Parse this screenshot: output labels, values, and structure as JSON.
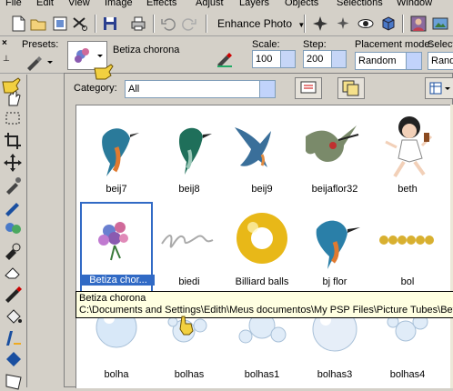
{
  "menu": [
    "File",
    "Edit",
    "View",
    "Image",
    "Effects",
    "Adjust",
    "Layers",
    "Objects",
    "Selections",
    "Window"
  ],
  "toolbar": {
    "enhance_photo": "Enhance Photo"
  },
  "options": {
    "presets_label": "Presets:",
    "tube_name": "Betiza chorona",
    "scale_label": "Scale:",
    "scale_value": "100",
    "step_label": "Step:",
    "step_value": "200",
    "placement_label": "Placement mode:",
    "placement_value": "Random",
    "selection_label": "Selecti",
    "selection_value": "Rando"
  },
  "browser": {
    "category_label": "Category:",
    "category_value": "All",
    "items": [
      "beij7",
      "beij8",
      "beij9",
      "beijaflor32",
      "beth",
      "Betiza chor...",
      "biedi",
      "Billiard balls",
      "bj flor",
      "bol",
      "bolha",
      "bolhas",
      "bolhas1",
      "bolhas3",
      "bolhas4"
    ],
    "selected_index": 5
  },
  "tooltip": {
    "title": "Betiza chorona",
    "path": "C:\\Documents and Settings\\Edith\\Meus documentos\\My PSP Files\\Picture Tubes\\Betiza"
  },
  "colors": {
    "selection": "#316ac5",
    "tooltip_bg": "#ffffe1",
    "face": "#d4d0c8"
  }
}
